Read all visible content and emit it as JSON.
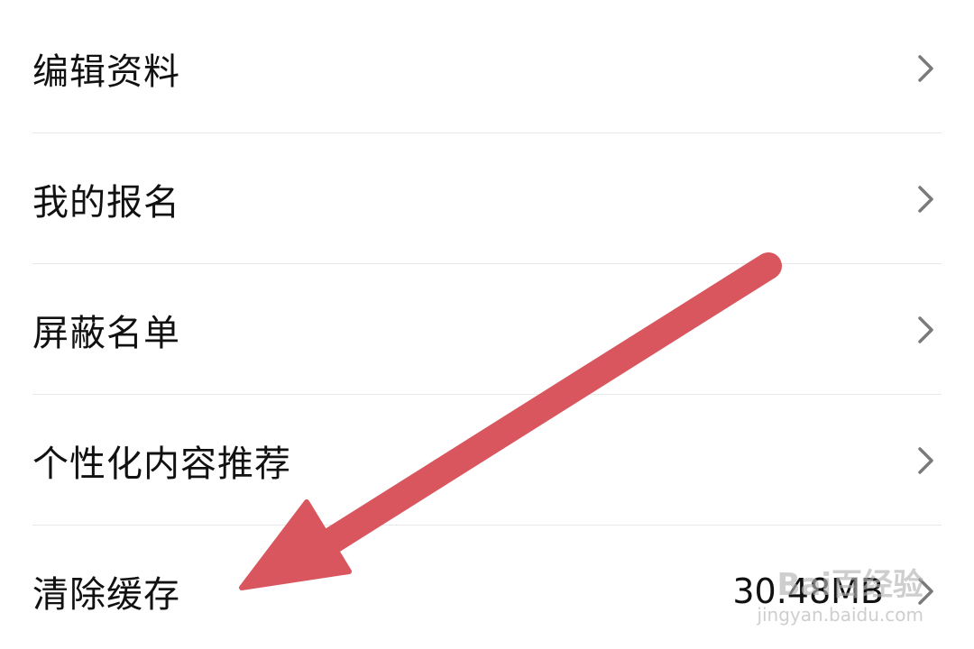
{
  "settings": {
    "items": [
      {
        "label": "编辑资料",
        "value": ""
      },
      {
        "label": "我的报名",
        "value": ""
      },
      {
        "label": "屏蔽名单",
        "value": ""
      },
      {
        "label": "个性化内容推荐",
        "value": ""
      },
      {
        "label": "清除缓存",
        "value": "30.48MB"
      }
    ]
  },
  "icons": {
    "chevron": "chevron-right-icon",
    "annotation": "red-arrow-annotation"
  },
  "colors": {
    "arrow": "#d9565f",
    "text": "#111111",
    "chevron": "#7a7a7a",
    "divider": "#e8e8e8"
  },
  "watermark": {
    "main": "Bai百经验",
    "sub": "jingyan.baidu.com"
  }
}
